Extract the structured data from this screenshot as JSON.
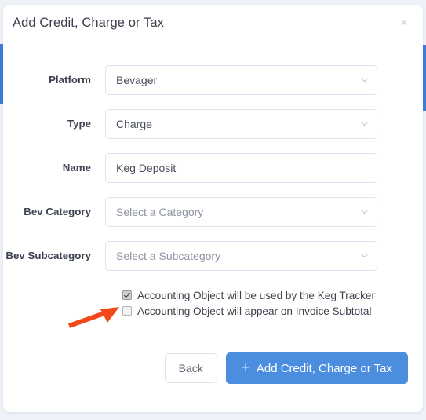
{
  "modal": {
    "title": "Add Credit, Charge or Tax",
    "close_icon": "close-icon",
    "close_glyph": "×"
  },
  "form": {
    "fields": [
      {
        "label": "Platform",
        "type": "select",
        "value": "Bevager",
        "is_placeholder": false,
        "icon": "chevron-down-icon"
      },
      {
        "label": "Type",
        "type": "select",
        "value": "Charge",
        "is_placeholder": false,
        "icon": "chevron-down-icon"
      },
      {
        "label": "Name",
        "type": "text",
        "value": "Keg Deposit",
        "placeholder": "",
        "is_placeholder": false,
        "icon": ""
      },
      {
        "label": "Bev Category",
        "type": "select",
        "value": "Select a Category",
        "is_placeholder": true,
        "icon": "chevron-down-icon"
      },
      {
        "label": "Bev Subcategory",
        "type": "select",
        "value": "Select a Subcategory",
        "is_placeholder": true,
        "icon": "chevron-down-icon"
      }
    ],
    "checkboxes": [
      {
        "label": "Accounting Object will be used by the Keg Tracker",
        "checked": true
      },
      {
        "label": "Accounting Object will appear on Invoice Subtotal",
        "checked": false
      }
    ]
  },
  "footer": {
    "back_label": "Back",
    "submit_label": "Add Credit, Charge or Tax",
    "submit_plus": "+"
  },
  "annotation": {
    "arrow_icon": "arrow-pointer-icon",
    "arrow_color": "#f4481a",
    "points_at": "Accounting Object will be used by the Keg Tracker"
  },
  "colors": {
    "accent_blue": "#4b8ddf",
    "page_background": "#dfe3ec",
    "modal_background": "#ffffff",
    "field_border": "#dde3f0"
  }
}
